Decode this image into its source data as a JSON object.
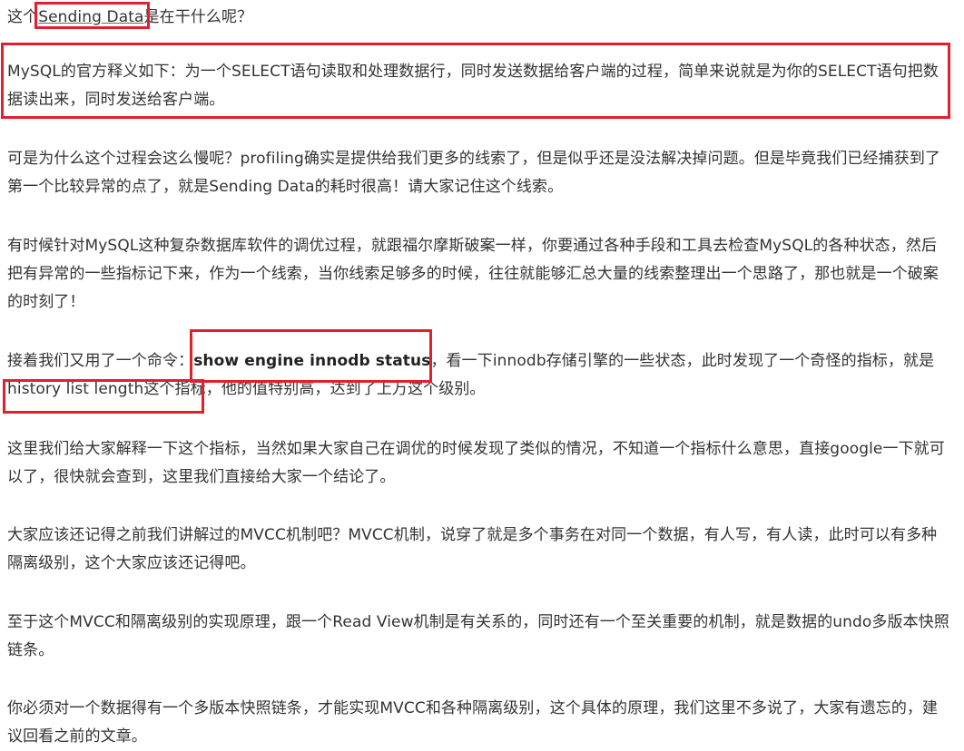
{
  "article": {
    "p1": {
      "pre": "这个",
      "highlight": "Sending Data",
      "post": "是在干什么呢？"
    },
    "p2": "MySQL的官方释义如下：为一个SELECT语句读取和处理数据行，同时发送数据给客户端的过程，简单来说就是为你的SELECT语句把数据读出来，同时发送给客户端。",
    "p3": "可是为什么这个过程会这么慢呢？profiling确实是提供给我们更多的线索了，但是似乎还是没法解决掉问题。但是毕竟我们已经捕获到了第一个比较异常的点了，就是Sending Data的耗时很高！请大家记住这个线索。",
    "p4": "有时候针对MySQL这种复杂数据库软件的调优过程，就跟福尔摩斯破案一样，你要通过各种手段和工具去检查MySQL的各种状态，然后把有异常的一些指标记下来，作为一个线索，当你线索足够多的时候，往往就能够汇总大量的线索整理出一个思路了，那也就是一个破案的时刻了！",
    "p5": {
      "pre": "接着我们又用了一个命令：",
      "command": "show engine innodb status",
      "mid": "，看一下innodb存储引擎的一些状态，此时发现了一个奇怪的指标，就是",
      "metric": "history list length这个指标",
      "post": "，他的值特别高，达到了上万这个级别。"
    },
    "p6": "这里我们给大家解释一下这个指标，当然如果大家自己在调优的时候发现了类似的情况，不知道一个指标什么意思，直接google一下就可以了，很快就会查到，这里我们直接给大家一个结论了。",
    "p7": "大家应该还记得之前我们讲解过的MVCC机制吧？MVCC机制，说穿了就是多个事务在对同一个数据，有人写，有人读，此时可以有多种隔离级别，这个大家应该还记得吧。",
    "p8": "至于这个MVCC和隔离级别的实现原理，跟一个Read View机制是有关系的，同时还有一个至关重要的机制，就是数据的undo多版本快照链条。",
    "p9": "你必须对一个数据得有一个多版本快照链条，才能实现MVCC和各种隔离级别，这个具体的原理，我们这里不多说了，大家有遗忘的，建议回看之前的文章。"
  }
}
